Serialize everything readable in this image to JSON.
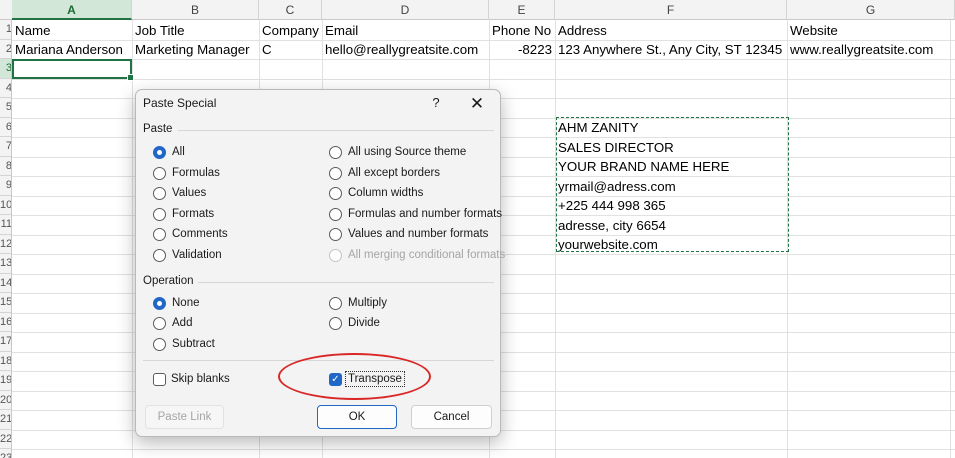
{
  "sheet": {
    "columns": [
      "A",
      "B",
      "C",
      "D",
      "E",
      "F",
      "G"
    ],
    "rows": [
      "1",
      "2",
      "3",
      "4",
      "5",
      "6",
      "7",
      "8",
      "9",
      "10",
      "11",
      "12",
      "13",
      "14",
      "15",
      "16",
      "17",
      "18",
      "19",
      "20",
      "21",
      "22",
      "23"
    ],
    "header_cells": {
      "a": "Name",
      "b": "Job Title",
      "c": "Company",
      "d": "Email",
      "e": "Phone No",
      "f": "Address",
      "g": "Website"
    },
    "data_row": {
      "a": "Mariana Anderson",
      "b": "Marketing Manager",
      "c": "C",
      "d": "hello@reallygreatsite.com",
      "e": "-8223",
      "f": "123 Anywhere St., Any City, ST 12345",
      "g": "www.reallygreatsite.com"
    },
    "card": [
      "AHM ZANITY",
      "SALES DIRECTOR",
      "YOUR BRAND NAME HERE",
      "yrmail@adress.com",
      "+225 444 998 365",
      "adresse, city 6654",
      "yourwebsite.com"
    ]
  },
  "dialog": {
    "title": "Paste Special",
    "help": "?",
    "close": "✕",
    "paste_group": "Paste",
    "paste_left": [
      "All",
      "Formulas",
      "Values",
      "Formats",
      "Comments",
      "Validation"
    ],
    "paste_right": [
      "All using Source theme",
      "All except borders",
      "Column widths",
      "Formulas and number formats",
      "Values and number formats",
      "All merging conditional formats"
    ],
    "operation_group": "Operation",
    "operation_left": [
      "None",
      "Add",
      "Subtract"
    ],
    "operation_right": [
      "Multiply",
      "Divide"
    ],
    "skip_blanks": "Skip blanks",
    "transpose": "Transpose",
    "paste_link": "Paste Link",
    "ok": "OK",
    "cancel": "Cancel",
    "selected_paste": "All",
    "selected_operation": "None",
    "transpose_checked": true,
    "skip_blanks_checked": false
  },
  "colors": {
    "accent_green": "#217346",
    "accent_blue": "#2167c6",
    "highlight_red": "#d92727"
  }
}
